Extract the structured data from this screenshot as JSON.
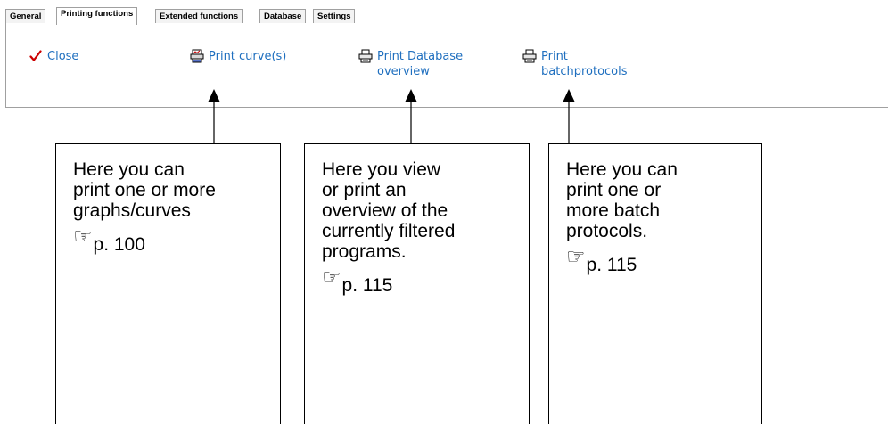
{
  "tabs": [
    {
      "label": "General",
      "active": false
    },
    {
      "label": "Printing functions",
      "active": true
    },
    {
      "label": "Extended functions",
      "active": false
    },
    {
      "label": "Database",
      "active": false
    },
    {
      "label": "Settings",
      "active": false
    }
  ],
  "actions": {
    "close": {
      "label": "Close",
      "icon": "checkmark-icon"
    },
    "print_curves": {
      "label": "Print curve(s)",
      "icon": "print-chart-icon"
    },
    "print_db_overview": {
      "label": "Print Database\noverview",
      "icon": "printer-icon"
    },
    "print_batch": {
      "label": "Print\nbatchprotocols",
      "icon": "printer-icon"
    }
  },
  "callouts": [
    {
      "text": "Here you can\nprint one or more\ngraphs/curves",
      "ref_icon": "pointing-hand-icon",
      "ref_page": "p. 100"
    },
    {
      "text": "Here you view\nor  print an\noverview of the\ncurrently filtered\nprograms.",
      "ref_icon": "pointing-hand-icon",
      "ref_page": "p. 115"
    },
    {
      "text": "Here you can\nprint one or\nmore batch\nprotocols.",
      "ref_icon": "pointing-hand-icon",
      "ref_page": "p. 115"
    }
  ],
  "colors": {
    "link": "#1f6fbf",
    "check": "#cc0000",
    "border": "#a0a0a0"
  }
}
